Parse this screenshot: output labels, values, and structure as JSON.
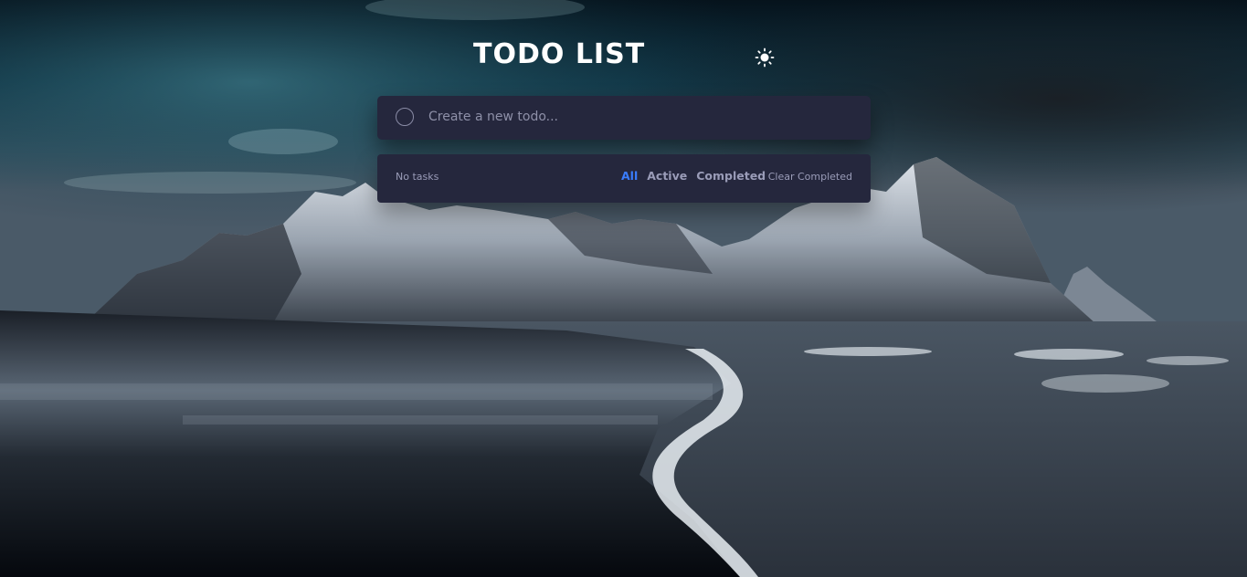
{
  "app": {
    "title": "TODO LIST"
  },
  "theme_toggle": {
    "icon": "sun-icon"
  },
  "new_todo": {
    "placeholder": "Create a new todo...",
    "value": ""
  },
  "footer": {
    "count_text": "No tasks",
    "filters": [
      {
        "label": "All",
        "active": true
      },
      {
        "label": "Active",
        "active": false
      },
      {
        "label": "Completed",
        "active": false
      }
    ],
    "clear_label": "Clear Completed"
  },
  "colors": {
    "card": "#25273d",
    "accent": "#3a7cfd",
    "muted": "#9a9cb8",
    "title": "#ffffff"
  }
}
